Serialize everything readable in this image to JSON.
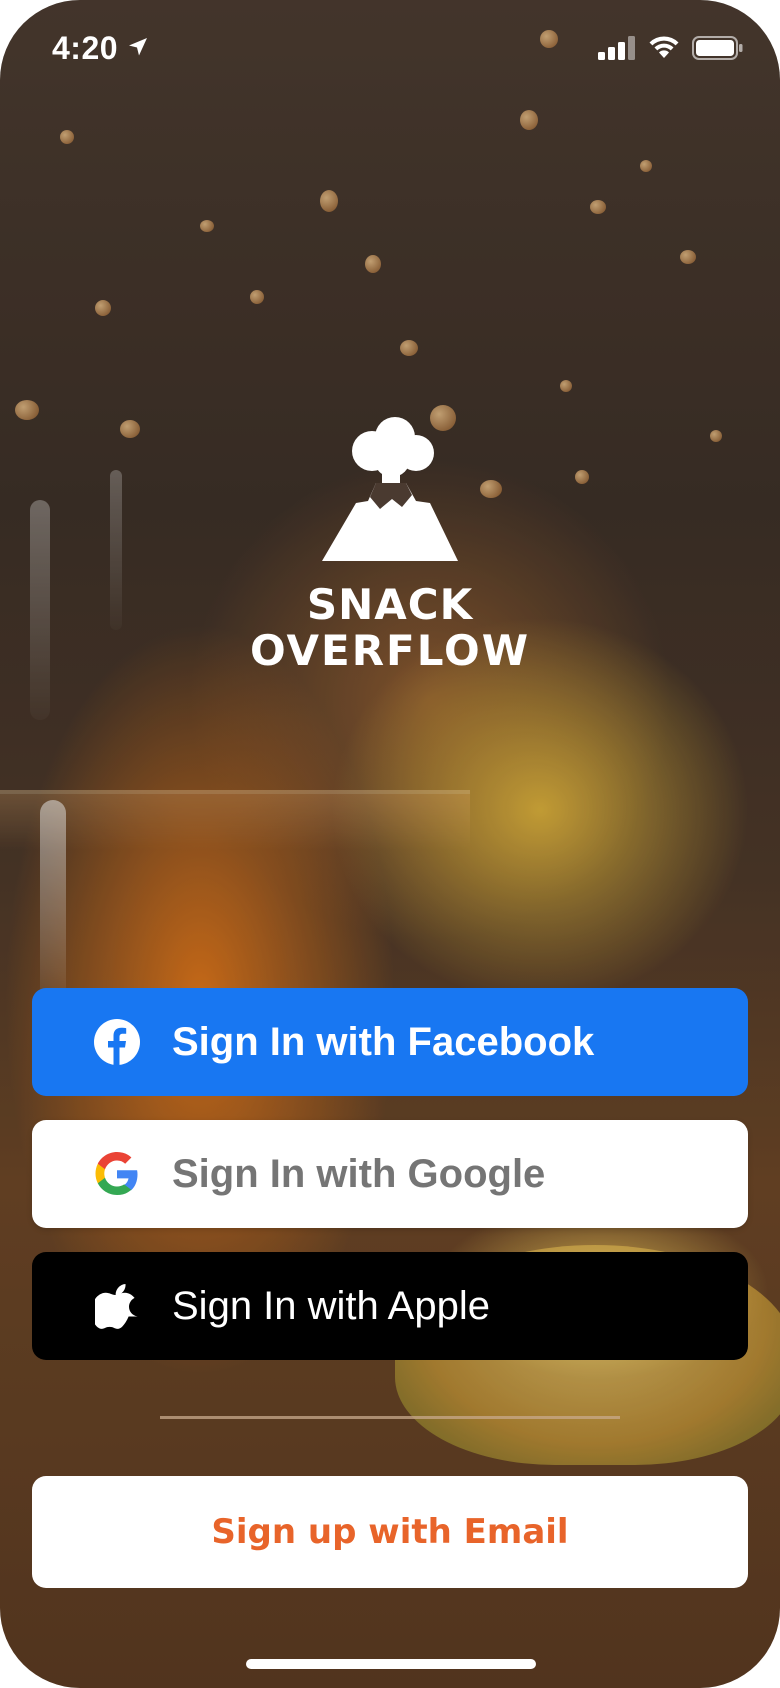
{
  "status_bar": {
    "time": "4:20",
    "icons": [
      "location-arrow-icon",
      "signal-icon",
      "wifi-icon",
      "battery-icon"
    ]
  },
  "logo": {
    "line1": "SNACK",
    "line2": "OVERFLOW",
    "icon": "volcano-icon"
  },
  "buttons": {
    "facebook": {
      "label": "Sign In with Facebook",
      "icon": "facebook-icon",
      "color": "#1877f2"
    },
    "google": {
      "label": "Sign In with Google",
      "icon": "google-icon",
      "color": "#ffffff"
    },
    "apple": {
      "label": "Sign In with Apple",
      "icon": "apple-icon",
      "color": "#000000"
    },
    "email": {
      "label": "Sign up with Email",
      "color": "#e8642a"
    }
  }
}
